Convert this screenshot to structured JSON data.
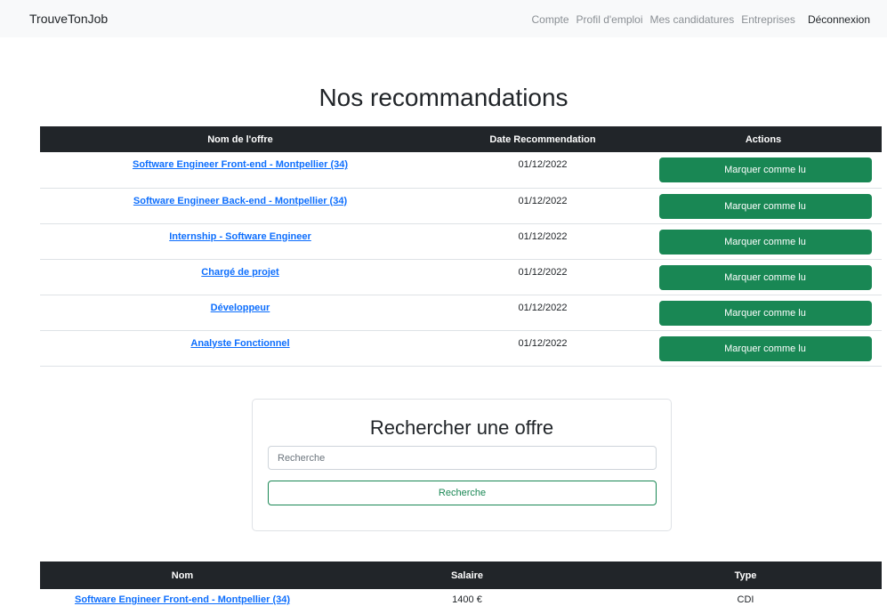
{
  "navbar": {
    "brand": "TrouveTonJob",
    "links": [
      "Compte",
      "Profil d'emploi",
      "Mes candidatures",
      "Entreprises"
    ],
    "logout": "Déconnexion"
  },
  "recommendations": {
    "title": "Nos recommandations",
    "headers": [
      "Nom de l'offre",
      "Date Recommendation",
      "Actions"
    ],
    "action_label": "Marquer comme lu",
    "rows": [
      {
        "offer": "Software Engineer Front-end - Montpellier (34)",
        "date": "01/12/2022"
      },
      {
        "offer": "Software Engineer Back-end - Montpellier (34)",
        "date": "01/12/2022"
      },
      {
        "offer": "Internship - Software Engineer",
        "date": "01/12/2022"
      },
      {
        "offer": "Chargé de projet",
        "date": "01/12/2022"
      },
      {
        "offer": "Développeur",
        "date": "01/12/2022"
      },
      {
        "offer": "Analyste Fonctionnel",
        "date": "01/12/2022"
      }
    ]
  },
  "search": {
    "title": "Rechercher une offre",
    "placeholder": "Recherche",
    "button_label": "Recherche"
  },
  "offers": {
    "headers": [
      "Nom",
      "Salaire",
      "Type"
    ],
    "rows": [
      {
        "name": "Software Engineer Front-end - Montpellier (34)",
        "salary": "1400 €",
        "type": "CDI"
      }
    ]
  },
  "colors": {
    "primary_link": "#0d6efd",
    "success": "#198754",
    "header_dark": "#212529",
    "navbar_bg": "#f8f9fa"
  }
}
